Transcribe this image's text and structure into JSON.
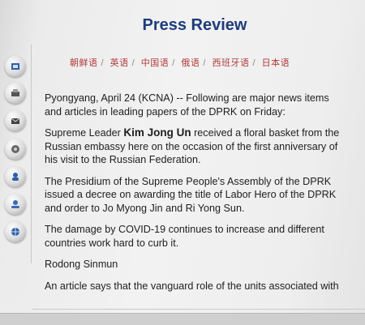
{
  "page": {
    "title": "Press Review"
  },
  "languages": [
    "朝鲜语",
    "英语",
    "中国语",
    "俄语",
    "西班牙语",
    "日本语"
  ],
  "sidebar": {
    "icons": [
      "home-icon",
      "print-icon",
      "mail-icon",
      "photo-icon",
      "person-icon",
      "user-icon",
      "globe-icon"
    ]
  },
  "article": {
    "dateline": "Pyongyang, April 24 (KCNA) -- Following are major news items and articles in leading papers of the DPRK on Friday:",
    "item1_before": "Supreme Leader ",
    "item1_name": "Kim Jong Un",
    "item1_after": " received a floral basket from the Russian embassy here on the occasion of the first anniversary of his visit to the Russian Federation.",
    "item2": "The Presidium of the Supreme People's Assembly of the DPRK issued a decree on awarding the title of Labor Hero of the DPRK and order to Jo Myong Jin and Ri Yong Sun.",
    "item3": "The damage by COVID-19 continues to increase and different countries work hard to curb it.",
    "section": "Rodong Sinmun",
    "item4": "An article says that the vanguard role of the units associated with"
  }
}
